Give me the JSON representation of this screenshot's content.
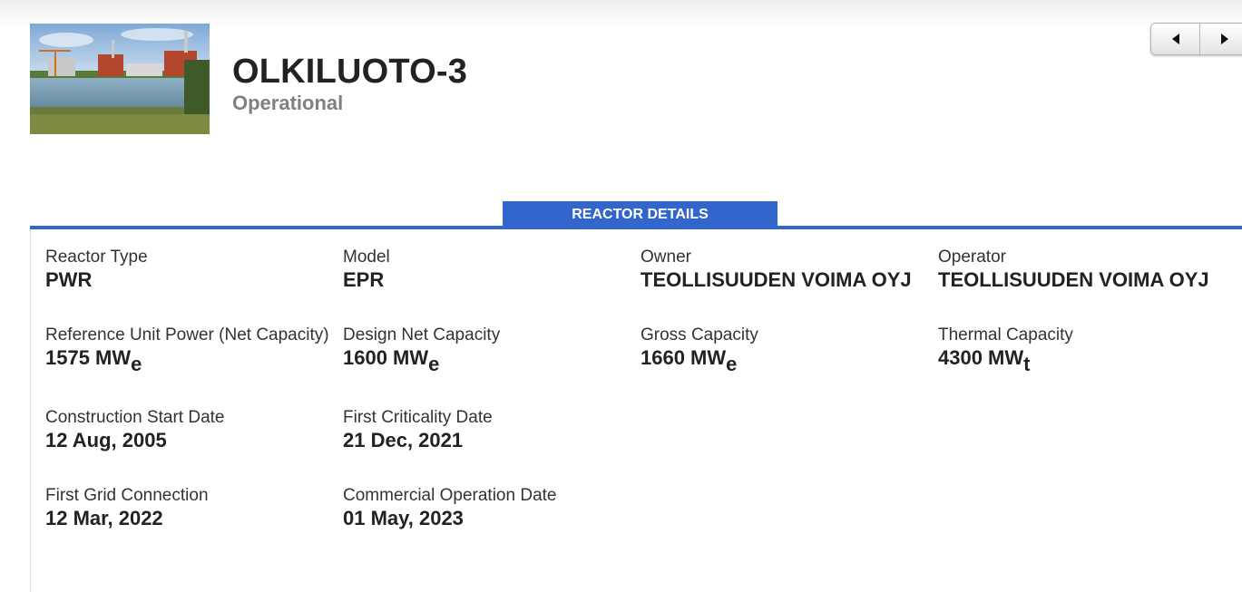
{
  "header": {
    "title": "OLKILUOTO-3",
    "status": "Operational"
  },
  "pager": {
    "prev_icon": "triangle-left-icon",
    "next_icon": "triangle-right-icon"
  },
  "section": {
    "title": "REACTOR DETAILS"
  },
  "details": {
    "reactor_type": {
      "label": "Reactor Type",
      "value": "PWR"
    },
    "model": {
      "label": "Model",
      "value": "EPR"
    },
    "owner": {
      "label": "Owner",
      "value": "TEOLLISUUDEN VOIMA OYJ"
    },
    "operator": {
      "label": "Operator",
      "value": "TEOLLISUUDEN VOIMA OYJ"
    },
    "reference_unit_power": {
      "label": "Reference Unit Power (Net Capacity)",
      "value": "1575 MW",
      "unit_sub": "e"
    },
    "design_net_capacity": {
      "label": "Design Net Capacity",
      "value": "1600 MW",
      "unit_sub": "e"
    },
    "gross_capacity": {
      "label": "Gross Capacity",
      "value": "1660 MW",
      "unit_sub": "e"
    },
    "thermal_capacity": {
      "label": "Thermal Capacity",
      "value": "4300 MW",
      "unit_sub": "t"
    },
    "construction_start": {
      "label": "Construction Start Date",
      "value": "12 Aug, 2005"
    },
    "first_criticality": {
      "label": "First Criticality Date",
      "value": "21 Dec, 2021"
    },
    "first_grid_connection": {
      "label": "First Grid Connection",
      "value": "12 Mar, 2022"
    },
    "commercial_operation": {
      "label": "Commercial Operation Date",
      "value": "01 May, 2023"
    }
  },
  "colors": {
    "accent": "#3366cc",
    "status_text": "#808080"
  }
}
